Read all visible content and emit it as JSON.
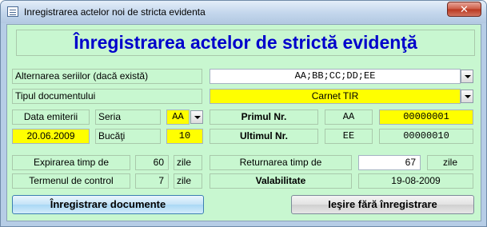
{
  "window": {
    "title": "Inregistrarea actelor noi de stricta evidenta",
    "close_glyph": "✕"
  },
  "form": {
    "heading": "Înregistrarea actelor de strictă evidenţă",
    "alternation_label": "Alternarea seriilor (dacă există)",
    "alternation_value": "AA;BB;CC;DD;EE",
    "doc_type_label": "Tipul documentului",
    "doc_type_value": "Carnet TIR",
    "issue_date_label": "Data emiterii",
    "issue_date_value": "20.06.2009",
    "series_label": "Seria",
    "series_value": "AA",
    "pieces_label": "Bucăţi",
    "pieces_value": "10",
    "first_no_label": "Primul Nr.",
    "first_series": "AA",
    "first_no_value": "00000001",
    "last_no_label": "Ultimul Nr.",
    "last_series": "EE",
    "last_no_value": "00000010",
    "expiry_label": "Expirarea timp de",
    "expiry_value": "60",
    "expiry_unit": "zile",
    "control_label": "Termenul de control",
    "control_value": "7",
    "control_unit": "zile",
    "return_label": "Returnarea timp de",
    "return_value": "67",
    "return_unit": "zile",
    "validity_label": "Valabilitate",
    "validity_value": "19-08-2009",
    "register_button": "Înregistrare documente",
    "exit_button": "Ieşire fără înregistrare"
  },
  "colors": {
    "form_background": "#c8f7d0",
    "heading_text": "#0000cc",
    "highlight": "#ffff00"
  }
}
